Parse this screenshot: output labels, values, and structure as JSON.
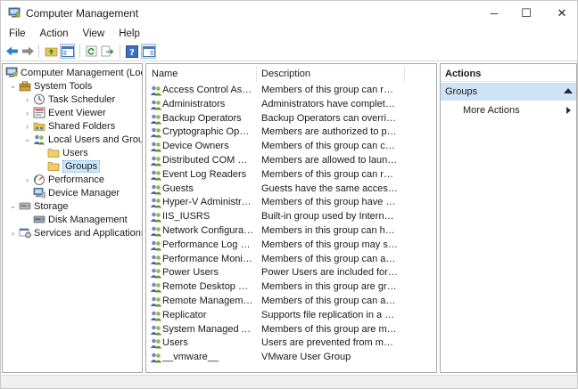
{
  "window": {
    "title": "Computer Management",
    "minimize_glyph": "─",
    "maximize_glyph": "☐",
    "close_glyph": "✕"
  },
  "menu": [
    "File",
    "Action",
    "View",
    "Help"
  ],
  "toolbar": {
    "buttons": [
      "back-arrow-icon",
      "forward-arrow-icon",
      "up-folder-icon",
      "show-hide-console-tree-icon",
      "refresh-icon",
      "export-list-icon",
      "help-icon",
      "show-hide-action-pane-icon"
    ]
  },
  "tree": {
    "root": "Computer Management (Local)",
    "system_tools": "System Tools",
    "task_scheduler": "Task Scheduler",
    "event_viewer": "Event Viewer",
    "shared_folders": "Shared Folders",
    "local_users_groups": "Local Users and Groups",
    "users": "Users",
    "groups": "Groups",
    "performance": "Performance",
    "device_manager": "Device Manager",
    "storage": "Storage",
    "disk_management": "Disk Management",
    "services_apps": "Services and Applications",
    "selected": "Groups"
  },
  "list": {
    "columns": [
      "Name",
      "Description"
    ],
    "rows": [
      {
        "name": "Access Control Assista...",
        "description": "Members of this group can remot..."
      },
      {
        "name": "Administrators",
        "description": "Administrators have complete and..."
      },
      {
        "name": "Backup Operators",
        "description": "Backup Operators can override sec..."
      },
      {
        "name": "Cryptographic Operat...",
        "description": "Members are authorized to perfor..."
      },
      {
        "name": "Device Owners",
        "description": "Members of this group can chang..."
      },
      {
        "name": "Distributed COM Users",
        "description": "Members are allowed to launch, ac..."
      },
      {
        "name": "Event Log Readers",
        "description": "Members of this group can read e..."
      },
      {
        "name": "Guests",
        "description": "Guests have the same access as m..."
      },
      {
        "name": "Hyper-V Administrators",
        "description": "Members of this group have comp..."
      },
      {
        "name": "IIS_IUSRS",
        "description": "Built-in group used by Internet Inf..."
      },
      {
        "name": "Network Configuratio...",
        "description": "Members in this group can have s..."
      },
      {
        "name": "Performance Log Users",
        "description": "Members of this group may sched..."
      },
      {
        "name": "Performance Monitor ...",
        "description": "Members of this group can access ..."
      },
      {
        "name": "Power Users",
        "description": "Power Users are included for back..."
      },
      {
        "name": "Remote Desktop Users",
        "description": "Members in this group are grante..."
      },
      {
        "name": "Remote Management ...",
        "description": "Members of this group can access ..."
      },
      {
        "name": "Replicator",
        "description": "Supports file replication in a doma..."
      },
      {
        "name": "System Managed Acco...",
        "description": "Members of this group are manag..."
      },
      {
        "name": "Users",
        "description": "Users are prevented from making ..."
      },
      {
        "name": "__vmware__",
        "description": "VMware User Group"
      }
    ]
  },
  "actions": {
    "header": "Actions",
    "group_title": "Groups",
    "more_actions": "More Actions"
  },
  "colors": {
    "selection": "#cce8ff",
    "action_group_bg": "#cfe3f6",
    "pane_border": "#a8a8a8",
    "accent_blue": "#1f6fc5"
  }
}
